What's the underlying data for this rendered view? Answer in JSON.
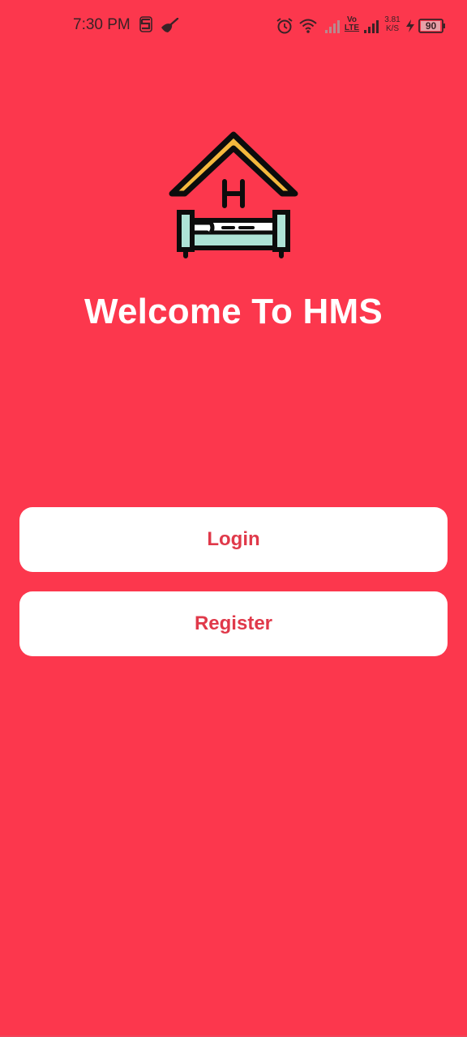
{
  "status_bar": {
    "time": "7:30 PM",
    "left_icons": [
      "s-notification-icon",
      "broom-icon"
    ],
    "volte_top": "Vo",
    "volte_bottom": "LTE",
    "speed_value": "3.81",
    "speed_unit": "K/S",
    "battery_level": "90",
    "right_icons": [
      "alarm-icon",
      "wifi-icon",
      "signal-icon",
      "volte-icon",
      "signal-icon",
      "network-speed",
      "charging-icon",
      "battery-icon"
    ]
  },
  "welcome": {
    "logo_icon": "hotel-bed-house-icon",
    "logo_letter": "H",
    "title": "Welcome To HMS"
  },
  "actions": {
    "login_label": "Login",
    "register_label": "Register"
  },
  "colors": {
    "background": "#fc374d",
    "button_bg": "#ffffff",
    "button_text": "#e0394a",
    "roof": "#f5b83d",
    "bed_sheet": "#aee3d6"
  }
}
